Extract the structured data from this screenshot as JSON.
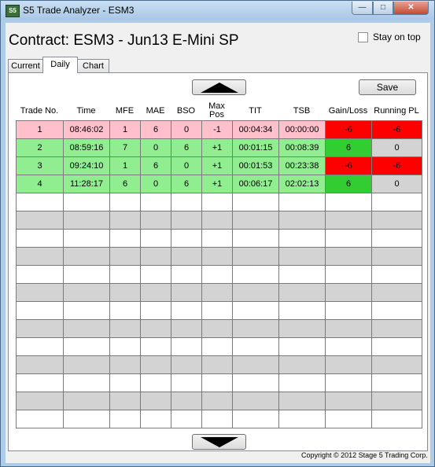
{
  "window": {
    "title": "S5 Trade Analyzer - ESM3",
    "icon_text": "S5",
    "buttons": {
      "minimize": "—",
      "maximize": "□",
      "close": "✕"
    }
  },
  "contract_label": "Contract: ESM3 - Jun13 E-Mini SP",
  "stay_on_top": {
    "label": "Stay on top",
    "checked": false
  },
  "tabs": [
    {
      "label": "Current",
      "active": false
    },
    {
      "label": "Daily",
      "active": true
    },
    {
      "label": "Chart",
      "active": false
    }
  ],
  "save_label": "Save",
  "columns": [
    "Trade No.",
    "Time",
    "MFE",
    "MAE",
    "BSO",
    "Max Pos",
    "TIT",
    "TSB",
    "Gain/Loss",
    "Running PL"
  ],
  "rows": [
    {
      "cells": [
        "1",
        "08:46:02",
        "1",
        "6",
        "0",
        "-1",
        "00:04:34",
        "00:00:00",
        "-6",
        "-6"
      ],
      "row_color": "#ffc0cb",
      "gain_color": "#ff0000",
      "pl_color": "#ff0000"
    },
    {
      "cells": [
        "2",
        "08:59:16",
        "7",
        "0",
        "6",
        "+1",
        "00:01:15",
        "00:08:39",
        "6",
        "0"
      ],
      "row_color": "#90ee90",
      "gain_color": "#32cd32",
      "pl_color": "#d3d3d3"
    },
    {
      "cells": [
        "3",
        "09:24:10",
        "1",
        "6",
        "0",
        "+1",
        "00:01:53",
        "00:23:38",
        "-6",
        "-6"
      ],
      "row_color": "#90ee90",
      "gain_color": "#ff0000",
      "pl_color": "#ff0000"
    },
    {
      "cells": [
        "4",
        "11:28:17",
        "6",
        "0",
        "6",
        "+1",
        "00:06:17",
        "02:02:13",
        "6",
        "0"
      ],
      "row_color": "#90ee90",
      "gain_color": "#32cd32",
      "pl_color": "#d3d3d3"
    }
  ],
  "empty_rows": 13,
  "copyright": "Copyright © 2012 Stage 5 Trading Corp."
}
